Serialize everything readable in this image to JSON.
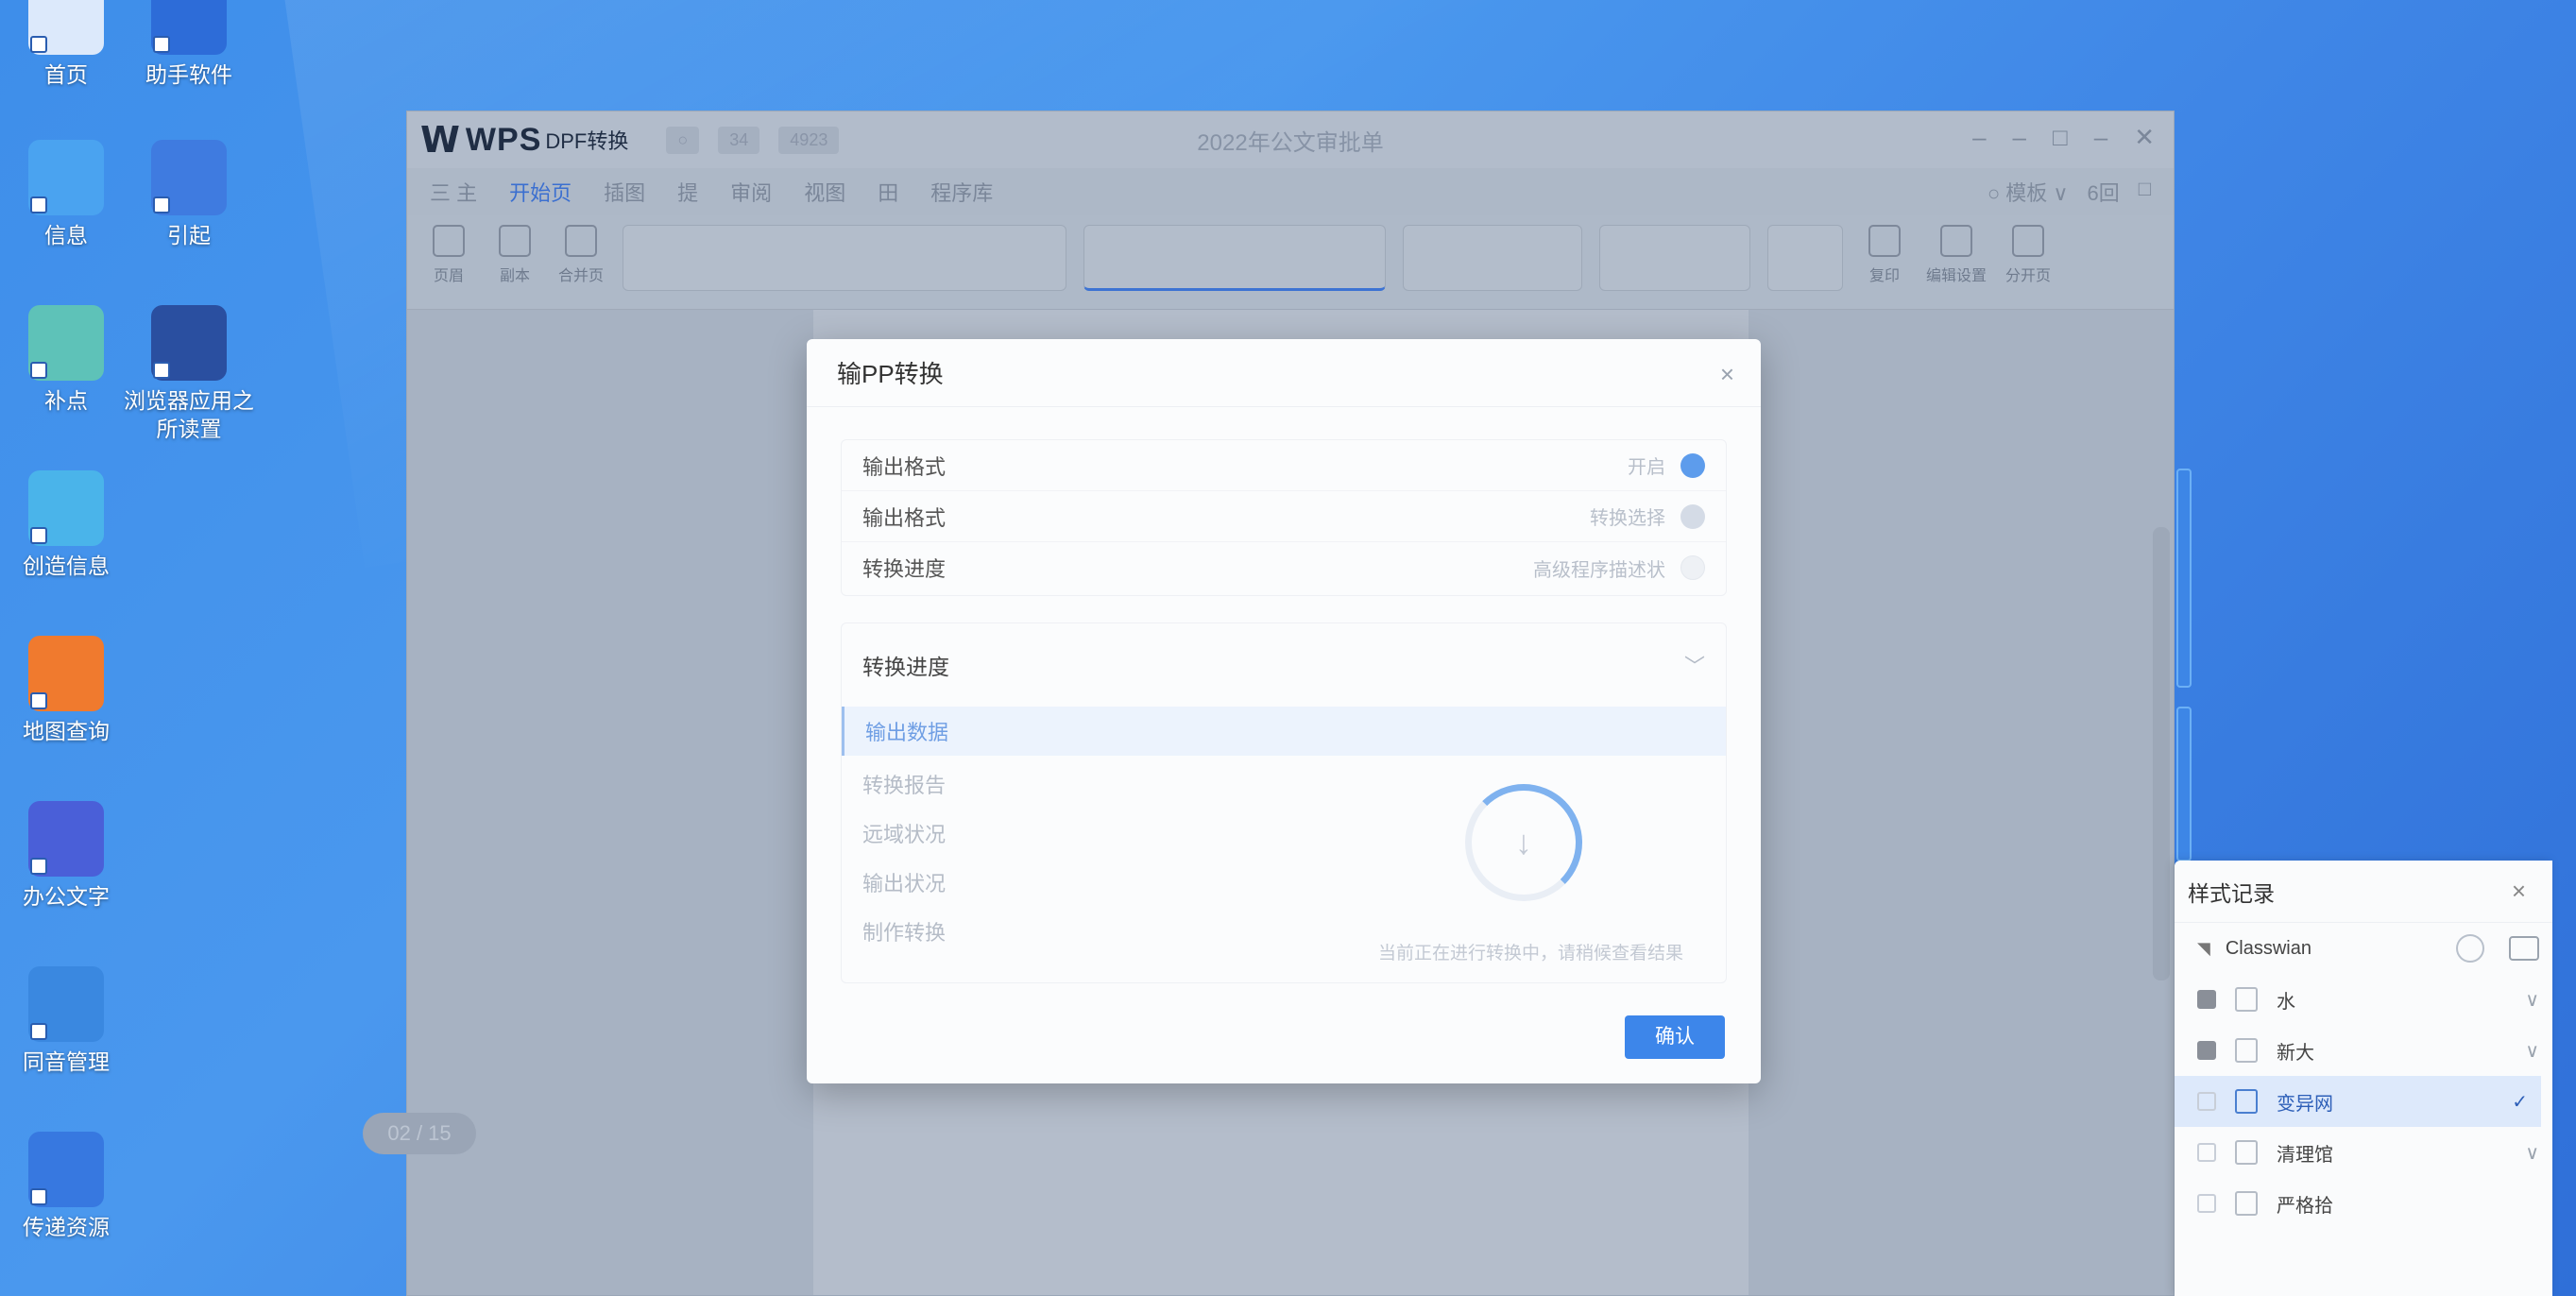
{
  "desktop": {
    "icons": [
      {
        "label": "首页",
        "icon": "pc-icon",
        "color": "#dce9fb"
      },
      {
        "label": "助手软件",
        "icon": "colorful-app-icon",
        "color": "#2d6cd8"
      },
      {
        "label": "信息",
        "icon": "notes-icon",
        "color": "#4aa3f0"
      },
      {
        "label": "引起",
        "icon": "box-icon",
        "color": "#3f7be0"
      },
      {
        "label": "补点",
        "icon": "folder-icon",
        "color": "#5ec2b8"
      },
      {
        "label": "浏览器应用之所读置",
        "icon": "screen-app-icon",
        "color": "#2a4fa0"
      },
      {
        "label": "创造信息",
        "icon": "cube-icon",
        "color": "#4ab4ea"
      },
      {
        "label": "地图查询",
        "icon": "orange-shield-icon",
        "color": "#f07a2e"
      },
      {
        "label": "办公文字",
        "icon": "compass-icon",
        "color": "#4a5fd8"
      },
      {
        "label": "同音管理",
        "icon": "orange-blue-icon",
        "color": "#3a88e0"
      },
      {
        "label": "传递资源",
        "icon": "pages-icon",
        "color": "#3778e0"
      }
    ]
  },
  "wps": {
    "brand": "WPS",
    "product": "DPF转换",
    "doc_title": "2022年公文审批单",
    "title_mini": [
      "○",
      "34",
      "4923"
    ],
    "menu": [
      "三 主",
      "开始页",
      "插图",
      "提",
      "审阅",
      "视图",
      "田",
      "程序库"
    ],
    "menu_active": "开始页",
    "menu_right": [
      "○ 模板 ∨",
      "6回",
      "□"
    ],
    "ribbon_items": [
      "页眉",
      "副本",
      "合并页"
    ],
    "ribbon_right": [
      "复印",
      "编辑设置",
      "分开页"
    ],
    "page_indicator": "02 / 15"
  },
  "modal": {
    "title": "输PP转换",
    "close": "×",
    "options": [
      {
        "label": "输出格式",
        "value": "开启",
        "dot_color": "#5d9cec"
      },
      {
        "label": "输出格式",
        "value": "转换选择",
        "dot_color": "#d4dbe6"
      },
      {
        "label": "转换进度",
        "value": "高级程序描述状",
        "dot_color": "#eef1f5"
      }
    ],
    "progress": {
      "header": "转换进度",
      "items": [
        "输出数据",
        "转换报告",
        "远域状况",
        "输出状况",
        "制作转换"
      ],
      "selected": "输出数据",
      "note": "当前正在进行转换中，请稍候查看结果"
    },
    "confirm": "确认"
  },
  "panel": {
    "title": "样式记录",
    "close": "×",
    "header_row": "Classwian",
    "rows": [
      {
        "label": "水",
        "checked": true
      },
      {
        "label": "新大",
        "checked": true
      },
      {
        "label": "变异网",
        "checked": false,
        "selected": true
      },
      {
        "label": "清理馆",
        "checked": false
      },
      {
        "label": "严格拾",
        "checked": false
      }
    ]
  }
}
